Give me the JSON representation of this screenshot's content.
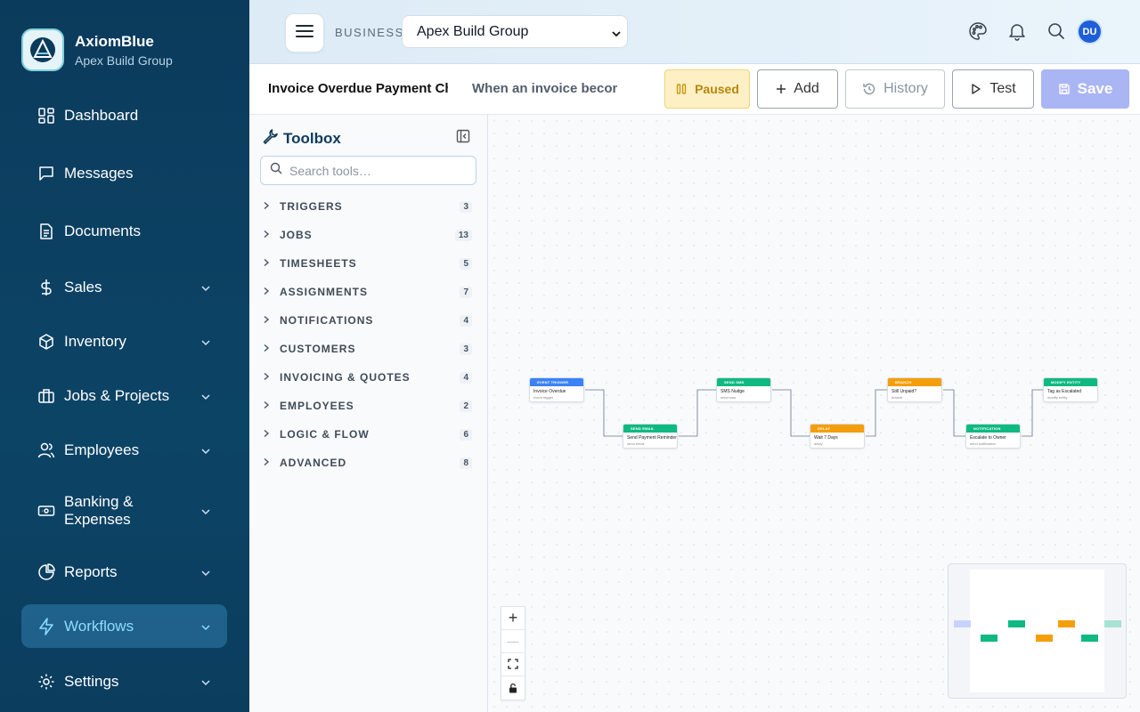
{
  "brand": {
    "name": "AxiomBlue",
    "subtitle": "Apex Build Group"
  },
  "sidebar": {
    "items": [
      {
        "label": "Dashboard",
        "icon": "dashboard-icon",
        "expandable": false,
        "active": false
      },
      {
        "label": "Messages",
        "icon": "chat-icon",
        "expandable": false,
        "active": false
      },
      {
        "label": "Documents",
        "icon": "document-icon",
        "expandable": false,
        "active": false
      },
      {
        "label": "Sales",
        "icon": "dollar-icon",
        "expandable": true,
        "active": false
      },
      {
        "label": "Inventory",
        "icon": "box-icon",
        "expandable": true,
        "active": false
      },
      {
        "label": "Jobs & Projects",
        "icon": "briefcase-icon",
        "expandable": true,
        "active": false
      },
      {
        "label": "Employees",
        "icon": "users-icon",
        "expandable": true,
        "active": false
      },
      {
        "label": "Banking & Expenses",
        "icon": "banknote-icon",
        "expandable": true,
        "active": false
      },
      {
        "label": "Reports",
        "icon": "pie-chart-icon",
        "expandable": true,
        "active": false
      },
      {
        "label": "Workflows",
        "icon": "lightning-icon",
        "expandable": true,
        "active": true
      },
      {
        "label": "Settings",
        "icon": "gear-icon",
        "expandable": true,
        "active": false
      }
    ]
  },
  "topbar": {
    "business_label": "BUSINESS",
    "business_selected": "Apex Build Group",
    "avatar_initials": "DU"
  },
  "workflow": {
    "name": "Invoice Overdue Payment Chase",
    "description": "When an invoice becomes overdue",
    "status_label": "Paused",
    "add_label": "Add",
    "history_label": "History",
    "test_label": "Test",
    "save_label": "Save"
  },
  "toolbox": {
    "title": "Toolbox",
    "search_placeholder": "Search tools…",
    "categories": [
      {
        "label": "TRIGGERS",
        "count": "3"
      },
      {
        "label": "JOBS",
        "count": "13"
      },
      {
        "label": "TIMESHEETS",
        "count": "5"
      },
      {
        "label": "ASSIGNMENTS",
        "count": "7"
      },
      {
        "label": "NOTIFICATIONS",
        "count": "4"
      },
      {
        "label": "CUSTOMERS",
        "count": "3"
      },
      {
        "label": "INVOICING & QUOTES",
        "count": "4"
      },
      {
        "label": "EMPLOYEES",
        "count": "2"
      },
      {
        "label": "LOGIC & FLOW",
        "count": "6"
      },
      {
        "label": "ADVANCED",
        "count": "8"
      }
    ]
  },
  "canvas": {
    "nodes": [
      {
        "header": "EVENT TRIGGER",
        "title": "Invoice Overdue",
        "sub": "event trigger",
        "color": "#3b82f6"
      },
      {
        "header": "SEND EMAIL",
        "title": "Send Payment Reminder",
        "sub": "send email",
        "color": "#10b981"
      },
      {
        "header": "SEND SMS",
        "title": "SMS Nudge",
        "sub": "send sms",
        "color": "#10b981"
      },
      {
        "header": "DELAY",
        "title": "Wait 7 Days",
        "sub": "delay",
        "color": "#f59e0b"
      },
      {
        "header": "BRANCH",
        "title": "Still Unpaid?",
        "sub": "branch",
        "color": "#f59e0b"
      },
      {
        "header": "NOTIFICATION",
        "title": "Escalate to Owner",
        "sub": "send notification",
        "color": "#10b981"
      },
      {
        "header": "MODIFY ENTITY",
        "title": "Tag as Escalated",
        "sub": "modify entity",
        "color": "#10b981"
      }
    ],
    "zoom_in": "+",
    "zoom_out": "—"
  },
  "colors": {
    "sidebar_bg": "#0b3b5c",
    "accent": "#1e5fd8",
    "paused": "#fdf0c4",
    "save_disabled": "#aab5f4"
  }
}
